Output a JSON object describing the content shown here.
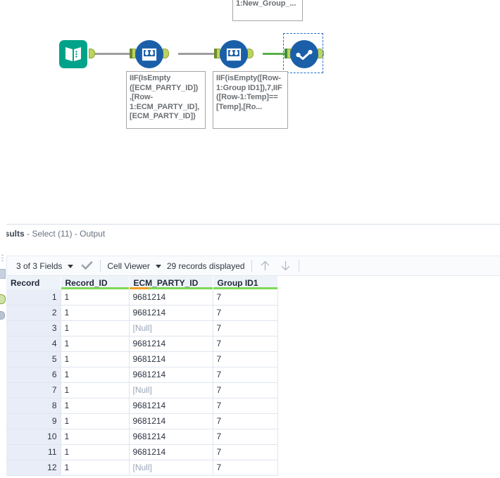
{
  "canvas": {
    "annotations": [
      {
        "id": "note-top",
        "text": "1:New_Group_..."
      },
      {
        "id": "note-formula-1",
        "text": "IIF(IsEmpty\n([ECM_PARTY_ID])\n,[Row-\n1:ECM_PARTY_ID],\n[ECM_PARTY_ID])"
      },
      {
        "id": "note-formula-2",
        "text": "IIF(isEmpty([Row-\n1:Group ID1]),7,IIF\n([Row-1:Temp]==\n[Temp],[Ro..."
      }
    ],
    "tools": [
      {
        "name": "input-data-tool",
        "icon": "book-icon",
        "color": "#00a389"
      },
      {
        "name": "multi-row-formula-tool-1",
        "icon": "beaker-droplet-icon",
        "color": "#1a5fa8"
      },
      {
        "name": "multi-row-formula-tool-2",
        "icon": "beaker-droplet-icon",
        "color": "#1a5fa8"
      },
      {
        "name": "select-tool",
        "icon": "checkmark-circle-icon",
        "color": "#1a5fa8",
        "selected": true
      }
    ],
    "connection_colors": {
      "inactive": "#9e9e9e",
      "active": "#5aaf4b"
    }
  },
  "results": {
    "title_bold": "esults",
    "title_rest": " - Select (11) - Output",
    "toolbar": {
      "fields_label": "3 of 3 Fields",
      "check_icon": "checkmark-icon",
      "view_mode_label": "Cell Viewer",
      "records_label": "29 records displayed",
      "up_arrow_icon": "arrow-up-icon",
      "down_arrow_icon": "arrow-down-icon"
    },
    "table": {
      "columns": [
        {
          "label": "Record",
          "type_color": "none"
        },
        {
          "label": "Record_ID",
          "type_color": "#7ed957"
        },
        {
          "label": "ECM_PARTY_ID",
          "type_color": "#f2a01e"
        },
        {
          "label": "Group ID1",
          "type_color": "#7ed957"
        }
      ],
      "rows": [
        {
          "record": "1",
          "record_id": "1",
          "ecm_party_id": "9681214",
          "group_id1": "7"
        },
        {
          "record": "2",
          "record_id": "1",
          "ecm_party_id": "9681214",
          "group_id1": "7"
        },
        {
          "record": "3",
          "record_id": "1",
          "ecm_party_id": "[Null]",
          "group_id1": "7"
        },
        {
          "record": "4",
          "record_id": "1",
          "ecm_party_id": "9681214",
          "group_id1": "7"
        },
        {
          "record": "5",
          "record_id": "1",
          "ecm_party_id": "9681214",
          "group_id1": "7"
        },
        {
          "record": "6",
          "record_id": "1",
          "ecm_party_id": "9681214",
          "group_id1": "7"
        },
        {
          "record": "7",
          "record_id": "1",
          "ecm_party_id": "[Null]",
          "group_id1": "7"
        },
        {
          "record": "8",
          "record_id": "1",
          "ecm_party_id": "9681214",
          "group_id1": "7"
        },
        {
          "record": "9",
          "record_id": "1",
          "ecm_party_id": "9681214",
          "group_id1": "7"
        },
        {
          "record": "10",
          "record_id": "1",
          "ecm_party_id": "9681214",
          "group_id1": "7"
        },
        {
          "record": "11",
          "record_id": "1",
          "ecm_party_id": "9681214",
          "group_id1": "7"
        },
        {
          "record": "12",
          "record_id": "1",
          "ecm_party_id": "[Null]",
          "group_id1": "7"
        }
      ]
    }
  }
}
